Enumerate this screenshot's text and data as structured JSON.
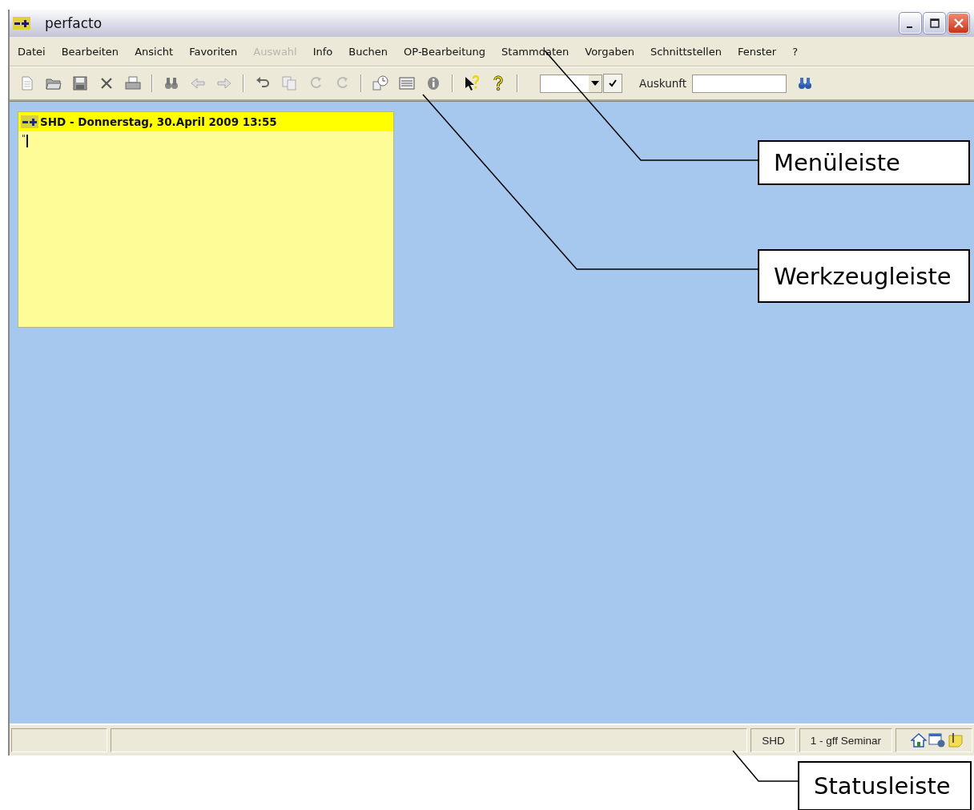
{
  "window": {
    "title": "perfacto"
  },
  "menu": [
    {
      "label": "Datei",
      "disabled": false
    },
    {
      "label": "Bearbeiten",
      "disabled": false
    },
    {
      "label": "Ansicht",
      "disabled": false
    },
    {
      "label": "Favoriten",
      "disabled": false
    },
    {
      "label": "Auswahl",
      "disabled": true
    },
    {
      "label": "Info",
      "disabled": false
    },
    {
      "label": "Buchen",
      "disabled": false
    },
    {
      "label": "OP-Bearbeitung",
      "disabled": false
    },
    {
      "label": "Stammdaten",
      "disabled": false
    },
    {
      "label": "Vorgaben",
      "disabled": false
    },
    {
      "label": "Schnittstellen",
      "disabled": false
    },
    {
      "label": "Fenster",
      "disabled": false
    },
    {
      "label": "?",
      "disabled": false
    }
  ],
  "toolbar": {
    "search_label": "Auskunft"
  },
  "note_window": {
    "title": "SHD - Donnerstag, 30.April 2009 13:55",
    "text": "\""
  },
  "status_bar": {
    "panels": [
      "SHD",
      "1 - gff Seminar"
    ]
  },
  "annotations": [
    {
      "label": "Menüleiste"
    },
    {
      "label": "Werkzeugleiste"
    },
    {
      "label": "Statusleiste"
    }
  ]
}
